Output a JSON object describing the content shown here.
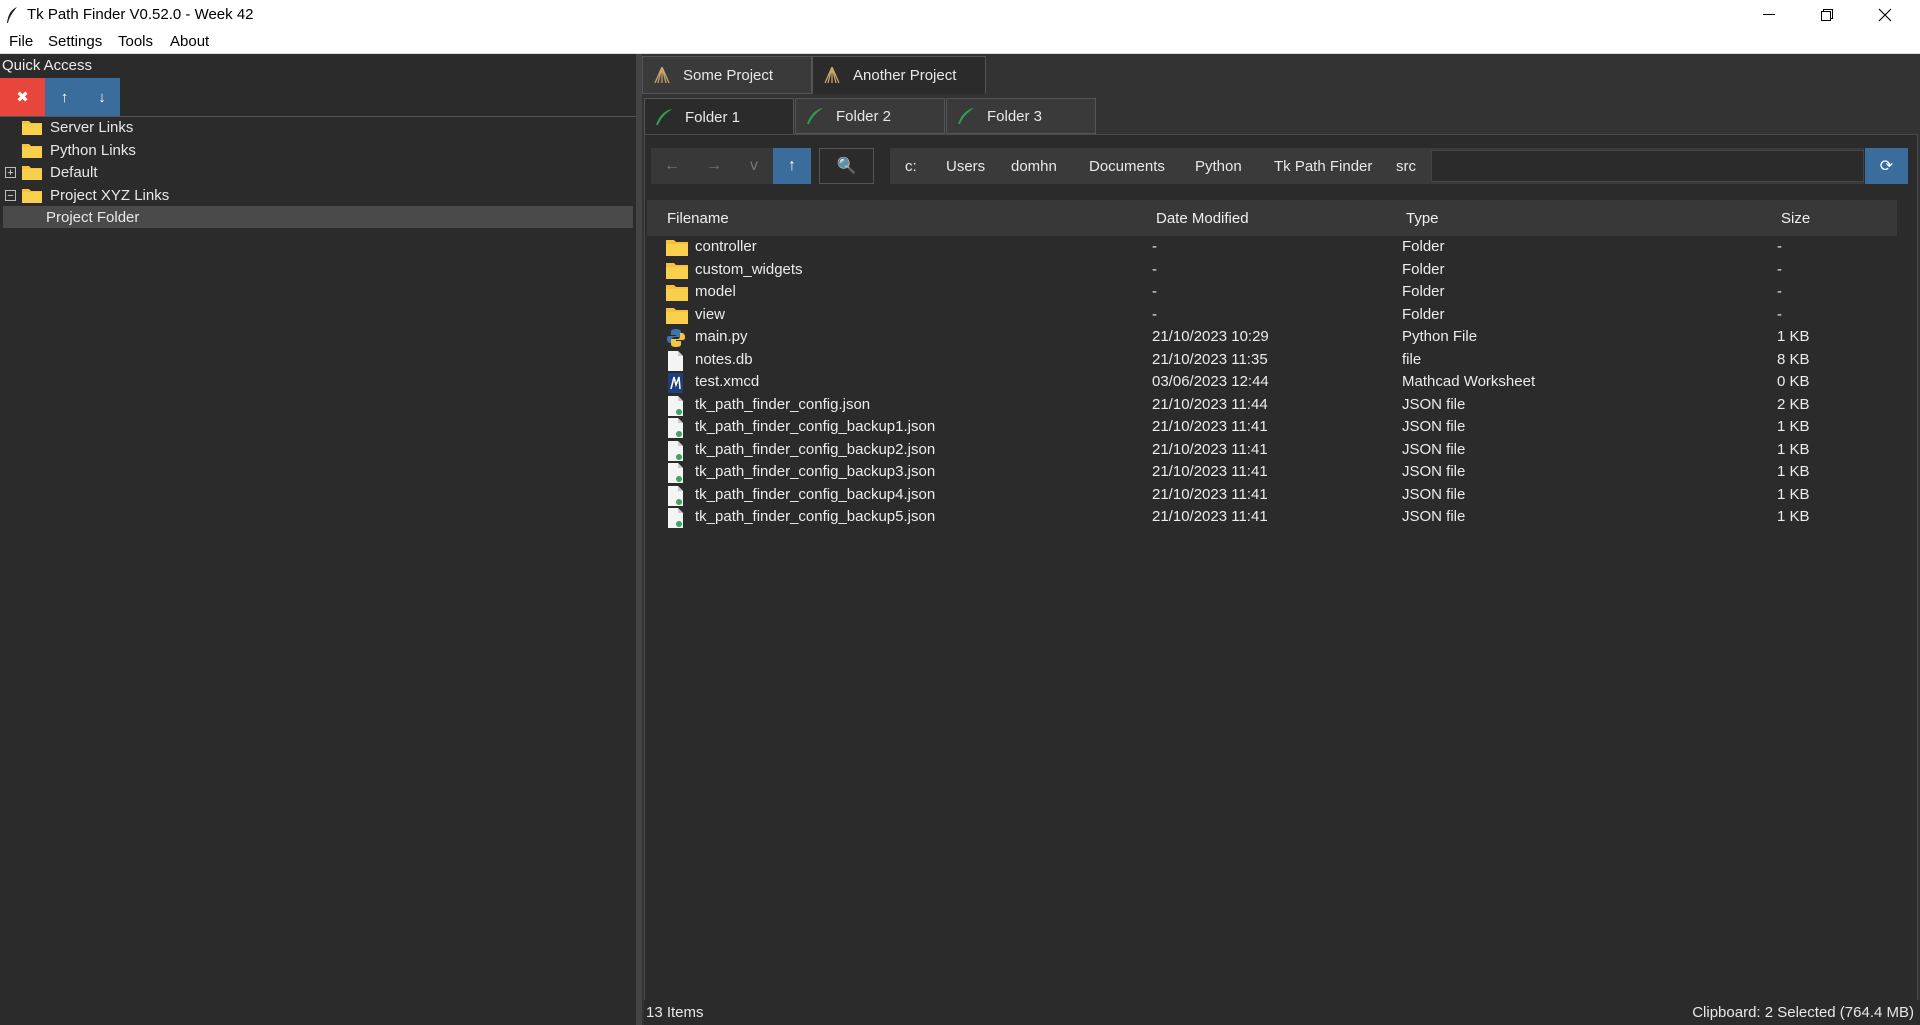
{
  "window": {
    "title": "Tk Path Finder V0.52.0 - Week 42"
  },
  "menu": [
    "File",
    "Settings",
    "Tools",
    "About"
  ],
  "quick_access": {
    "title": "Quick Access",
    "buttons": {
      "delete": "✖",
      "up": "↑",
      "down": "↓"
    },
    "tree": [
      {
        "label": "Server Links",
        "expander": ""
      },
      {
        "label": "Python Links",
        "expander": ""
      },
      {
        "label": "Default",
        "expander": "+"
      },
      {
        "label": "Project XYZ Links",
        "expander": "−"
      },
      {
        "label": "Project Folder",
        "expander": ""
      }
    ]
  },
  "project_tabs": [
    "Some Project",
    "Another Project"
  ],
  "folder_tabs": [
    "Folder 1",
    "Folder 2",
    "Folder 3"
  ],
  "nav": {
    "back": "←",
    "forward": "→",
    "history": "v",
    "up": "↑",
    "search": "🔍",
    "refresh": "⟳"
  },
  "breadcrumbs": [
    "c:",
    "Users",
    "domhn",
    "Documents",
    "Python",
    "Tk Path Finder",
    "src"
  ],
  "columns": {
    "filename": "Filename",
    "date": "Date Modified",
    "type": "Type",
    "size": "Size"
  },
  "files": [
    {
      "name": "controller",
      "date": "-",
      "type": "Folder",
      "size": "-",
      "icon": "folder-icon"
    },
    {
      "name": "custom_widgets",
      "date": "-",
      "type": "Folder",
      "size": "-",
      "icon": "folder-icon"
    },
    {
      "name": "model",
      "date": "-",
      "type": "Folder",
      "size": "-",
      "icon": "folder-icon"
    },
    {
      "name": "view",
      "date": "-",
      "type": "Folder",
      "size": "-",
      "icon": "folder-icon"
    },
    {
      "name": "main.py",
      "date": "21/10/2023  10:29",
      "type": "Python File",
      "size": "1 KB",
      "icon": "python-file-icon"
    },
    {
      "name": "notes.db",
      "date": "21/10/2023  11:35",
      "type": "file",
      "size": "8 KB",
      "icon": "file-icon"
    },
    {
      "name": "test.xmcd",
      "date": "03/06/2023  12:44",
      "type": "Mathcad Worksheet",
      "size": "0 KB",
      "icon": "mathcad-icon"
    },
    {
      "name": "tk_path_finder_config.json",
      "date": "21/10/2023  11:44",
      "type": "JSON file",
      "size": "2 KB",
      "icon": "json-file-icon"
    },
    {
      "name": "tk_path_finder_config_backup1.json",
      "date": "21/10/2023  11:41",
      "type": "JSON file",
      "size": "1 KB",
      "icon": "json-file-icon"
    },
    {
      "name": "tk_path_finder_config_backup2.json",
      "date": "21/10/2023  11:41",
      "type": "JSON file",
      "size": "1 KB",
      "icon": "json-file-icon"
    },
    {
      "name": "tk_path_finder_config_backup3.json",
      "date": "21/10/2023  11:41",
      "type": "JSON file",
      "size": "1 KB",
      "icon": "json-file-icon"
    },
    {
      "name": "tk_path_finder_config_backup4.json",
      "date": "21/10/2023  11:41",
      "type": "JSON file",
      "size": "1 KB",
      "icon": "json-file-icon"
    },
    {
      "name": "tk_path_finder_config_backup5.json",
      "date": "21/10/2023  11:41",
      "type": "JSON file",
      "size": "1 KB",
      "icon": "json-file-icon"
    }
  ],
  "status": {
    "items": "13 Items",
    "clipboard": "Clipboard: 2 Selected (764.4 MB)"
  },
  "colors": {
    "delete_button": "#e8453c",
    "blue_button": "#3b6d9c",
    "folder": "#f7c23a",
    "feather": "#2e9e4f"
  }
}
